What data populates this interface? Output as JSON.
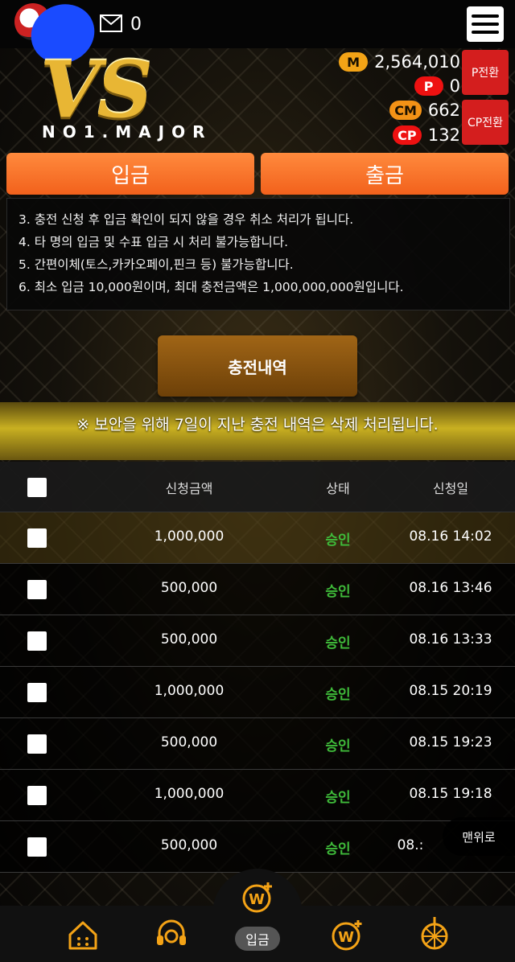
{
  "header": {
    "mail_count": "0",
    "logo": {
      "text": "VS",
      "subtitle": "NO1.MAJOR"
    }
  },
  "balances": [
    {
      "badge": "M",
      "value": "2,564,010"
    },
    {
      "badge": "P",
      "value": "0"
    },
    {
      "badge": "CM",
      "value": "662"
    },
    {
      "badge": "CP",
      "value": "132"
    }
  ],
  "convert_buttons": {
    "p": "P전환",
    "cp": "CP전환"
  },
  "actions": {
    "deposit": "입금",
    "withdraw": "출금"
  },
  "notices": [
    "3. 충전 신청 후 입금 확인이 되지 않을 경우 취소 처리가 됩니다.",
    "4. 타 명의 입금 및 수표 입금 시 처리 불가능합니다.",
    "5. 간편이체(토스,카카오페이,핀크 등) 불가능합니다.",
    "6. 최소 입금 10,000원이며, 최대 충전금액은 1,000,000,000원입니다."
  ],
  "history_button": "충전내역",
  "security_note": "※ 보안을 위해 7일이 지난 충전 내역은 삭제 처리됩니다.",
  "table": {
    "headers": {
      "amount": "신청금액",
      "status": "상태",
      "date": "신청일"
    },
    "rows": [
      {
        "amount": "1,000,000",
        "status": "승인",
        "date": "08.16 14:02"
      },
      {
        "amount": "500,000",
        "status": "승인",
        "date": "08.16 13:46"
      },
      {
        "amount": "500,000",
        "status": "승인",
        "date": "08.16 13:33"
      },
      {
        "amount": "1,000,000",
        "status": "승인",
        "date": "08.15 20:19"
      },
      {
        "amount": "500,000",
        "status": "승인",
        "date": "08.15 19:23"
      },
      {
        "amount": "1,000,000",
        "status": "승인",
        "date": "08.15 19:18"
      },
      {
        "amount": "500,000",
        "status": "승인",
        "date": "08.:"
      }
    ]
  },
  "scroll_top": "맨위로",
  "bottom_nav": {
    "active_label": "입금"
  },
  "colors": {
    "accent_orange": "#f2611c",
    "status_green": "#3fbb3a",
    "gold": "#f4a316",
    "convert_red": "#d41e1e"
  }
}
